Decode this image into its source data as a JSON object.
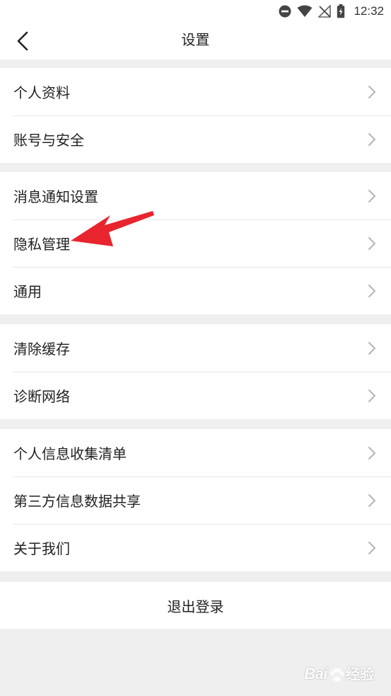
{
  "status_bar": {
    "time": "12:32",
    "icons": [
      "do-not-disturb-icon",
      "wifi-icon",
      "no-signal-icon",
      "battery-charging-icon"
    ]
  },
  "header": {
    "title": "设置",
    "back_icon": "chevron-left-icon"
  },
  "groups": [
    {
      "items": [
        {
          "label": "个人资料"
        },
        {
          "label": "账号与安全"
        }
      ]
    },
    {
      "items": [
        {
          "label": "消息通知设置"
        },
        {
          "label": "隐私管理"
        },
        {
          "label": "通用"
        }
      ]
    },
    {
      "items": [
        {
          "label": "清除缓存"
        },
        {
          "label": "诊断网络"
        }
      ]
    },
    {
      "items": [
        {
          "label": "个人信息收集清单"
        },
        {
          "label": "第三方信息数据共享"
        },
        {
          "label": "关于我们"
        }
      ]
    }
  ],
  "logout": {
    "label": "退出登录"
  },
  "annotation": {
    "icon": "red-arrow-icon",
    "color": "#e8252e",
    "target": "隐私管理"
  },
  "watermark": {
    "text_main": "Bai",
    "text_sub": "经验"
  },
  "colors": {
    "background": "#efefef",
    "surface": "#ffffff",
    "text": "#222222",
    "chevron": "#b5b5b5",
    "arrow": "#e8252e"
  }
}
